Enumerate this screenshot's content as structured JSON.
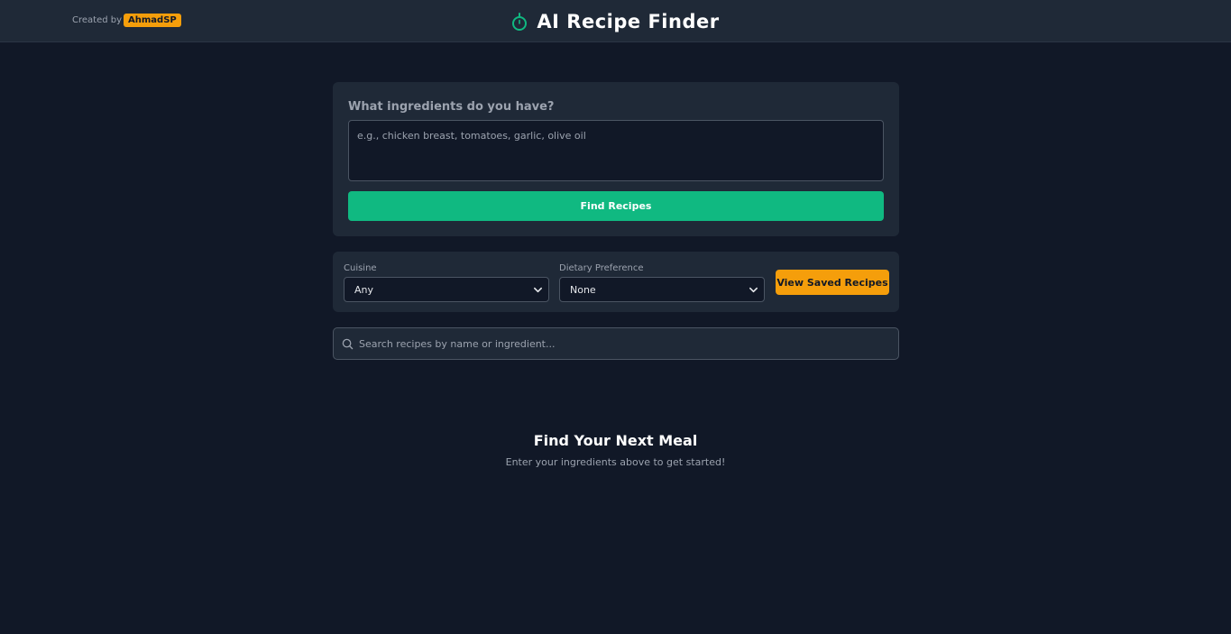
{
  "header": {
    "credit_prefix": "Created by",
    "credit_author": "AhmadSP",
    "title": "AI Recipe Finder",
    "icon": "timer-icon"
  },
  "ingredients": {
    "label": "What ingredients do you have?",
    "placeholder": "e.g., chicken breast, tomatoes, garlic, olive oil",
    "value": "",
    "button_label": "Find Recipes"
  },
  "filters": {
    "cuisine_label": "Cuisine",
    "cuisine_value": "Any",
    "dietary_label": "Dietary Preference",
    "dietary_value": "None",
    "saved_button_label": "View Saved Recipes"
  },
  "search": {
    "placeholder": "Search recipes by name or ingredient..."
  },
  "empty_state": {
    "title": "Find Your Next Meal",
    "subtitle": "Enter your ingredients above to get started!"
  },
  "colors": {
    "background": "#111827",
    "surface": "#1f2937",
    "accent_green": "#10b981",
    "accent_amber": "#f59e0b"
  }
}
